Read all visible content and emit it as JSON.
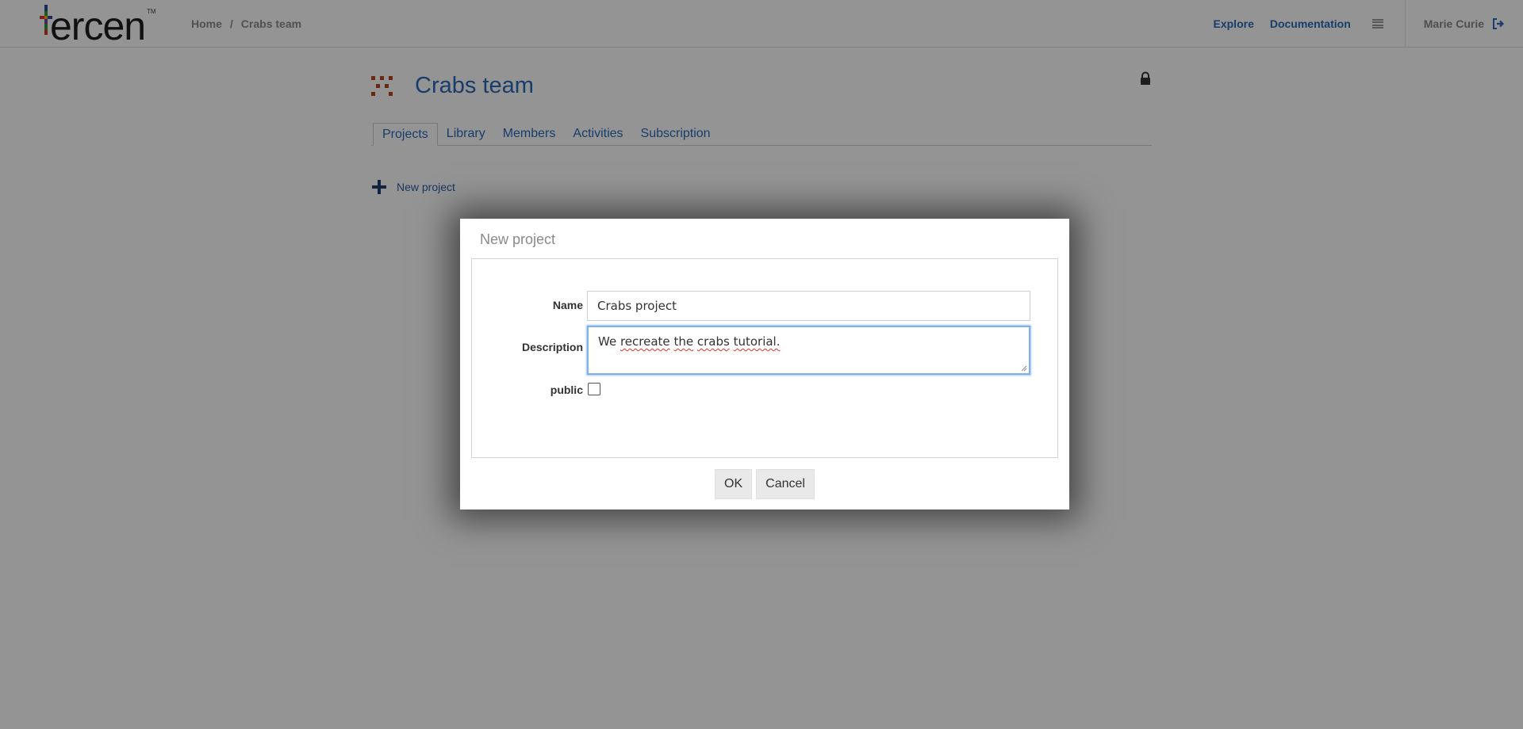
{
  "header": {
    "logo_text": "ercen",
    "logo_tm": "TM",
    "breadcrumb": [
      "Home",
      "/",
      "Crabs team"
    ],
    "nav_links": [
      "Explore",
      "Documentation"
    ],
    "user_name": "Marie Curie"
  },
  "team": {
    "title": "Crabs team",
    "tabs": [
      "Projects",
      "Library",
      "Members",
      "Activities",
      "Subscription"
    ],
    "active_tab": "Projects",
    "new_project_label": "New project"
  },
  "dialog": {
    "title": "New project",
    "name_label": "Name",
    "name_value": "Crabs project",
    "description_label": "Description",
    "description_words": [
      "We",
      "recreate",
      "the",
      "crabs",
      "tutorial."
    ],
    "public_label": "public",
    "public_checked": false,
    "ok_label": "OK",
    "cancel_label": "Cancel"
  },
  "colors": {
    "link_blue": "#2a6ab8",
    "overlay": "rgba(0,0,0,0.42)",
    "focus_border": "#7fb0e8"
  }
}
